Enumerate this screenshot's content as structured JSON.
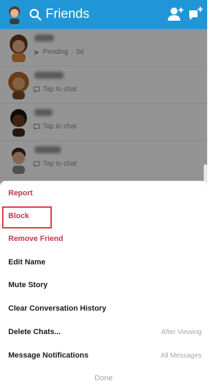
{
  "header": {
    "title": "Friends",
    "color": "#2196d6"
  },
  "friends": [
    {
      "status": "Pending",
      "separator": "·",
      "time": "3d",
      "status_icon": "sent-arrow-icon"
    },
    {
      "status": "Tap to chat",
      "status_icon": "chat-bubble-icon"
    },
    {
      "status": "Tap to chat",
      "status_icon": "chat-bubble-icon"
    },
    {
      "status": "Tap to chat",
      "status_icon": "chat-bubble-icon"
    }
  ],
  "sheet": {
    "report": "Report",
    "block": "Block",
    "remove_friend": "Remove Friend",
    "edit_name": "Edit Name",
    "mute_story": "Mute Story",
    "clear_history": "Clear Conversation History",
    "delete_chats": "Delete Chats...",
    "delete_chats_value": "After Viewing",
    "notifications": "Message Notifications",
    "notifications_value": "All Messages",
    "done": "Done"
  },
  "colors": {
    "destructive": "#c0364e",
    "highlight_box": "#d93a3f"
  }
}
